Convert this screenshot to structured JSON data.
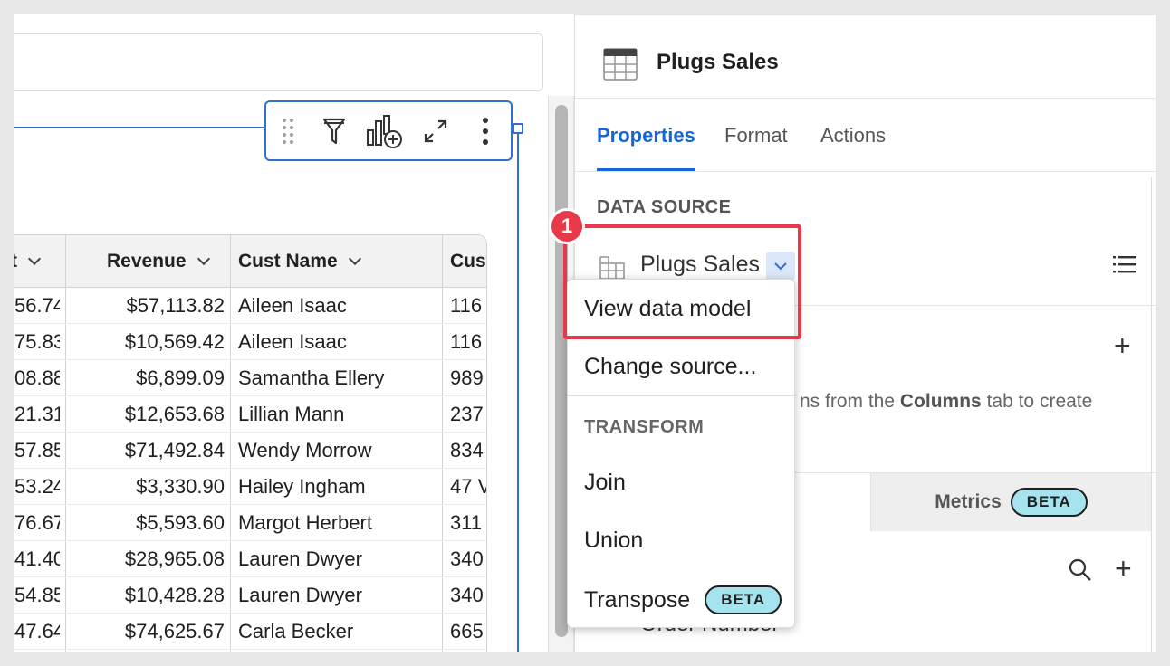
{
  "element_toolbar": {
    "icons": [
      "drag-handle-icon",
      "filter-icon",
      "add-chart-icon",
      "expand-icon",
      "more-options-icon"
    ]
  },
  "table": {
    "columns": [
      "t",
      "Revenue",
      "Cust Name",
      "Cust"
    ],
    "rows": [
      [
        "56.74",
        "$57,113.82",
        "Aileen Isaac",
        "116"
      ],
      [
        "75.83",
        "$10,569.42",
        "Aileen Isaac",
        "116"
      ],
      [
        "08.88",
        "$6,899.09",
        "Samantha Ellery",
        "989"
      ],
      [
        "21.31",
        "$12,653.68",
        "Lillian Mann",
        "237"
      ],
      [
        "57.85",
        "$71,492.84",
        "Wendy Morrow",
        "834"
      ],
      [
        "53.24",
        "$3,330.90",
        "Hailey Ingham",
        "47 V"
      ],
      [
        "76.67",
        "$5,593.60",
        "Margot Herbert",
        "311"
      ],
      [
        "41.40",
        "$28,965.08",
        "Lauren Dwyer",
        "340"
      ],
      [
        "54.85",
        "$10,428.28",
        "Lauren Dwyer",
        "340"
      ],
      [
        "47.64",
        "$74,625.67",
        "Carla Becker",
        "665"
      ]
    ]
  },
  "panel": {
    "title": "Plugs Sales",
    "tabs": [
      "Properties",
      "Format",
      "Actions"
    ],
    "active_tab": "Properties",
    "data_source_label": "DATA SOURCE",
    "data_source_name": "Plugs Sales",
    "hint_prefix": "ns from the ",
    "hint_bold": "Columns",
    "hint_suffix": " tab to create",
    "metrics_tab_label": "Metrics",
    "metrics_badge": "BETA",
    "partial_field": "Order Number"
  },
  "menu": {
    "view_data_model": "View data model",
    "change_source": "Change source...",
    "transform_label": "TRANSFORM",
    "join": "Join",
    "union": "Union",
    "transpose": "Transpose",
    "transpose_badge": "BETA"
  },
  "annotation": {
    "step_number": "1",
    "color": "#e8394a"
  },
  "colors": {
    "accent": "#1565d8",
    "badge_bg": "#a5e3ee",
    "highlight": "#e8394a"
  }
}
